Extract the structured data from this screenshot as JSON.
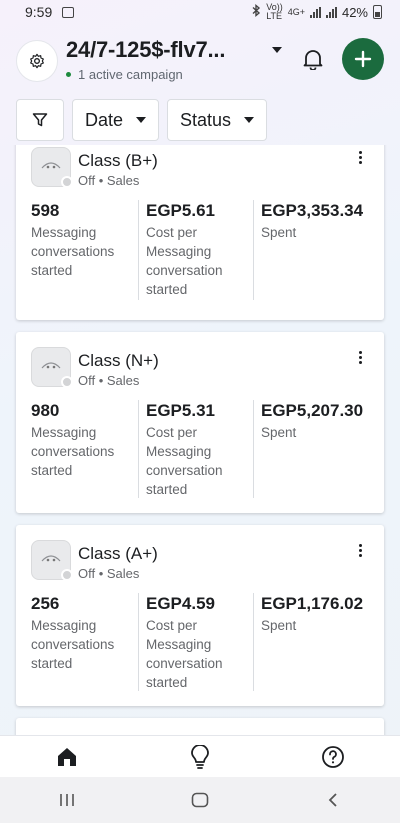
{
  "status_bar": {
    "time": "9:59",
    "lte_label": "Vo))\nLTE",
    "network_label": "4G+",
    "battery": "42%"
  },
  "header": {
    "account_name": "24/7-125$-flv7...",
    "active_campaigns": "1 active campaign",
    "accent_color": "#1b6b3e"
  },
  "filters": {
    "date_label": "Date",
    "status_label": "Status"
  },
  "campaigns": [
    {
      "name": "Class (B+)",
      "subtitle": "Off • Sales",
      "metrics": [
        {
          "value": "598",
          "label": "Messaging conversations started"
        },
        {
          "value": "EGP5.61",
          "label": "Cost per Messaging conversation started"
        },
        {
          "value": "EGP3,353.34",
          "label": "Spent"
        }
      ]
    },
    {
      "name": "Class (N+)",
      "subtitle": "Off • Sales",
      "metrics": [
        {
          "value": "980",
          "label": "Messaging conversations started"
        },
        {
          "value": "EGP5.31",
          "label": "Cost per Messaging conversation started"
        },
        {
          "value": "EGP5,207.30",
          "label": "Spent"
        }
      ]
    },
    {
      "name": "Class (A+)",
      "subtitle": "Off • Sales",
      "metrics": [
        {
          "value": "256",
          "label": "Messaging conversations started"
        },
        {
          "value": "EGP4.59",
          "label": "Cost per Messaging conversation started"
        },
        {
          "value": "EGP1,176.02",
          "label": "Spent"
        }
      ]
    }
  ],
  "bottom_nav": {
    "items": [
      "home-icon",
      "lightbulb-icon",
      "help-icon"
    ]
  }
}
